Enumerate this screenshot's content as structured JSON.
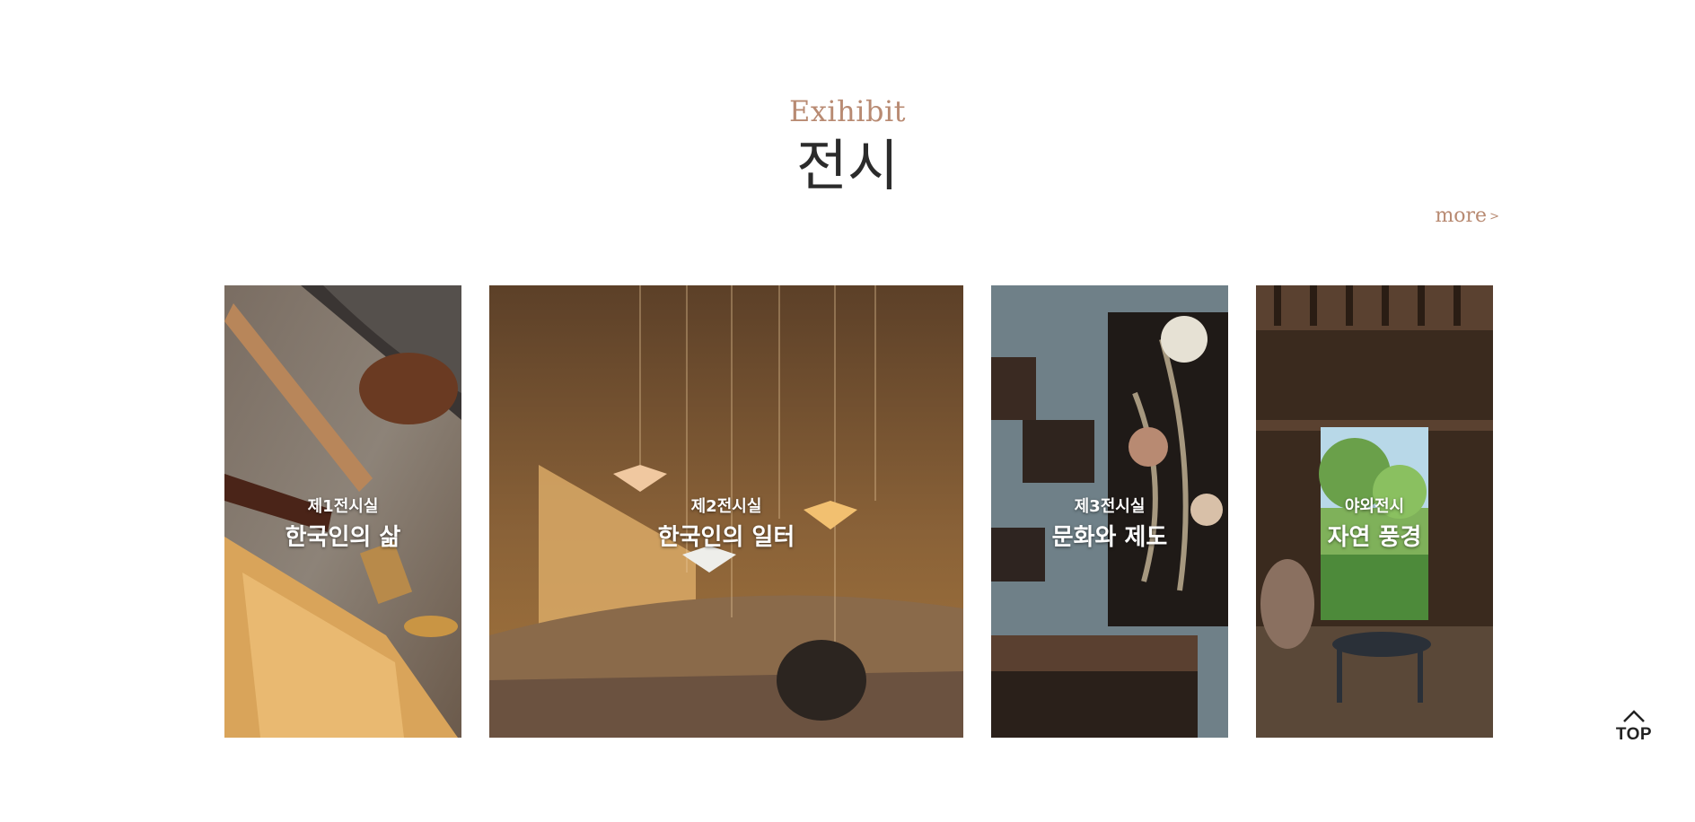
{
  "exhibit": {
    "eyebrow": "Exihibit",
    "title": "전시",
    "more_label": "more",
    "more_arrow": ">"
  },
  "cards": [
    {
      "subtitle": "제1전시실",
      "title": "한국인의 삶"
    },
    {
      "subtitle": "제2전시실",
      "title": "한국인의 일터"
    },
    {
      "subtitle": "제3전시실",
      "title": "문화와 제도"
    },
    {
      "subtitle": "야외전시",
      "title": "자연 풍경"
    }
  ],
  "top_button": {
    "label": "TOP",
    "icon": "chevron-up-icon"
  },
  "colors": {
    "accent": "#b88a72",
    "title": "#2b2b2b"
  }
}
